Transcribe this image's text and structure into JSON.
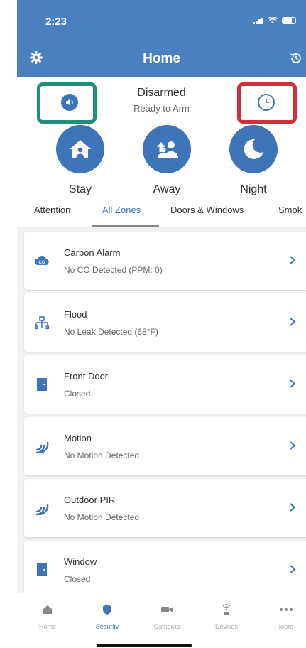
{
  "status_bar": {
    "time": "2:23"
  },
  "header": {
    "title": "Home",
    "settings_icon": "gear-icon",
    "history_icon": "history-icon"
  },
  "panel": {
    "state": "Disarmed",
    "sub": "Ready to Arm",
    "sound_icon": "speaker-icon",
    "schedule_icon": "clock-icon",
    "highlight_colors": {
      "left": "#1f8f7a",
      "right": "#d32f3a"
    },
    "arm_buttons": [
      {
        "label": "Stay",
        "icon": "house-person-icon"
      },
      {
        "label": "Away",
        "icon": "people-arrow-icon"
      },
      {
        "label": "Night",
        "icon": "moon-star-icon"
      }
    ]
  },
  "tabs": [
    "Attention",
    "All Zones",
    "Doors & Windows",
    "Smok"
  ],
  "active_tab": "All Zones",
  "zones": [
    {
      "name": "Carbon Alarm",
      "detail": "No CO Detected (PPM: 0)",
      "icon": "co-cloud-icon"
    },
    {
      "name": "Flood",
      "detail": "No Leak Detected (68°F)",
      "icon": "pipe-icon"
    },
    {
      "name": "Front Door",
      "detail": "Closed",
      "icon": "door-icon"
    },
    {
      "name": "Motion",
      "detail": "No Motion Detected",
      "icon": "motion-icon"
    },
    {
      "name": "Outdoor PIR",
      "detail": "No Motion Detected",
      "icon": "motion-icon"
    },
    {
      "name": "Window",
      "detail": "Closed",
      "icon": "window-icon"
    }
  ],
  "bottom_nav": [
    {
      "label": "Home",
      "icon": "home-icon"
    },
    {
      "label": "Security",
      "icon": "shield-icon"
    },
    {
      "label": "Cameras",
      "icon": "camera-icon"
    },
    {
      "label": "Devices",
      "icon": "devices-icon"
    },
    {
      "label": "More",
      "icon": "more-icon"
    }
  ],
  "active_nav": "Security",
  "colors": {
    "brand": "#4a7fc0",
    "accent": "#3d75b8"
  }
}
